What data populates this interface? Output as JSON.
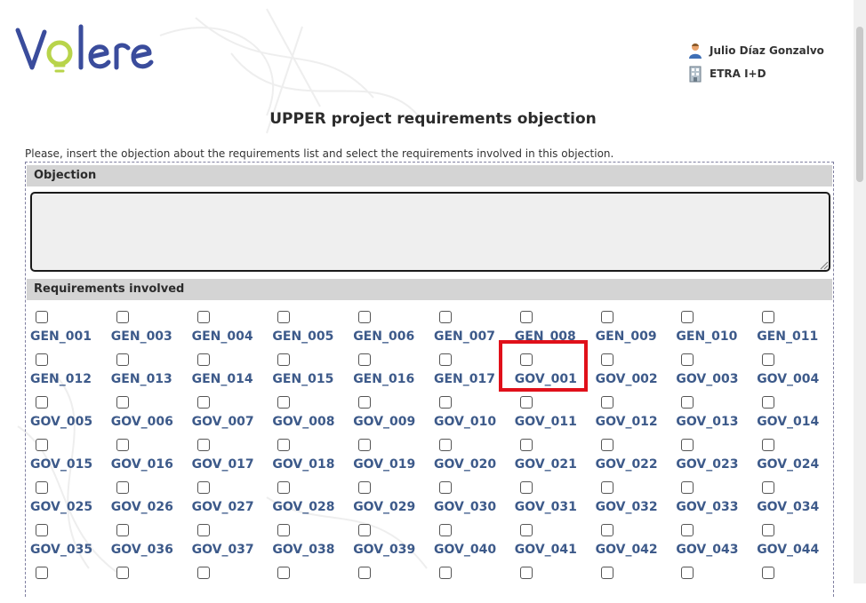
{
  "app": {
    "logo_text": "Volere",
    "user_name": "Julio Díaz Gonzalvo",
    "organization": "ETRA I+D"
  },
  "page": {
    "title": "UPPER project requirements objection",
    "instructions": "Please, insert the objection about the requirements list and select the requirements involved in this objection."
  },
  "objection": {
    "header": "Objection",
    "value": ""
  },
  "requirements": {
    "header": "Requirements involved",
    "highlighted": "GOV_001",
    "items": [
      "GEN_001",
      "GEN_003",
      "GEN_004",
      "GEN_005",
      "GEN_006",
      "GEN_007",
      "GEN_008",
      "GEN_009",
      "GEN_010",
      "GEN_011",
      "GEN_012",
      "GEN_013",
      "GEN_014",
      "GEN_015",
      "GEN_016",
      "GEN_017",
      "GOV_001",
      "GOV_002",
      "GOV_003",
      "GOV_004",
      "GOV_005",
      "GOV_006",
      "GOV_007",
      "GOV_008",
      "GOV_009",
      "GOV_010",
      "GOV_011",
      "GOV_012",
      "GOV_013",
      "GOV_014",
      "GOV_015",
      "GOV_016",
      "GOV_017",
      "GOV_018",
      "GOV_019",
      "GOV_020",
      "GOV_021",
      "GOV_022",
      "GOV_023",
      "GOV_024",
      "GOV_025",
      "GOV_026",
      "GOV_027",
      "GOV_028",
      "GOV_029",
      "GOV_030",
      "GOV_031",
      "GOV_032",
      "GOV_033",
      "GOV_034",
      "GOV_035",
      "GOV_036",
      "GOV_037",
      "GOV_038",
      "GOV_039",
      "GOV_040",
      "GOV_041",
      "GOV_042",
      "GOV_043",
      "GOV_044",
      "",
      "",
      "",
      "",
      "",
      "",
      "",
      "",
      "",
      ""
    ]
  },
  "icons": {
    "user": "user-icon",
    "organization": "building-icon"
  },
  "colors": {
    "requirement_code": "#3d5a8a",
    "section_header_bg": "#d4d4d4",
    "highlight_box": "#e0101a",
    "logo_blue": "#3a4c9c",
    "logo_bulb": "#b8d44a"
  }
}
